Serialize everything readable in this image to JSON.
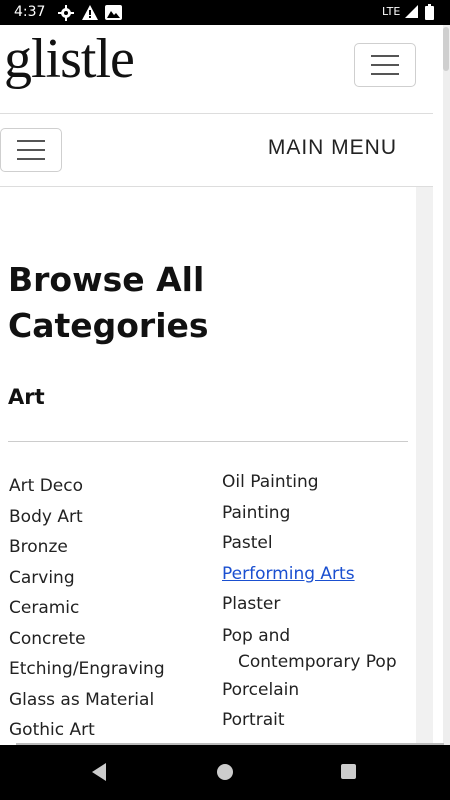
{
  "status_bar": {
    "time": "4:37",
    "network": "LTE",
    "icons": [
      "gear-icon",
      "alert-icon",
      "image-icon",
      "signal-icon",
      "battery-icon"
    ]
  },
  "header": {
    "logo": "glistle",
    "menu_icon": "hamburger-icon"
  },
  "menu_row": {
    "toggle_icon": "hamburger-icon",
    "label": "MAIN MENU"
  },
  "main": {
    "title": "Browse All Categories",
    "section": "Art",
    "left_column": [
      "Art Deco",
      "Body Art",
      "Bronze",
      "Carving",
      "Ceramic",
      "Concrete",
      "Etching/Engraving",
      "Glass as Material",
      "Gothic Art"
    ],
    "right_column": {
      "oil_painting": "Oil Painting",
      "painting": "Painting",
      "pastel": "Pastel",
      "performing_arts": "Performing Arts",
      "plaster": "Plaster",
      "pop_line1": "Pop and",
      "pop_line2": "Contemporary Pop",
      "porcelain": "Porcelain",
      "portrait": "Portrait"
    }
  },
  "colors": {
    "link": "#1a4fd0",
    "text": "#222222",
    "status_bar": "#000000"
  }
}
